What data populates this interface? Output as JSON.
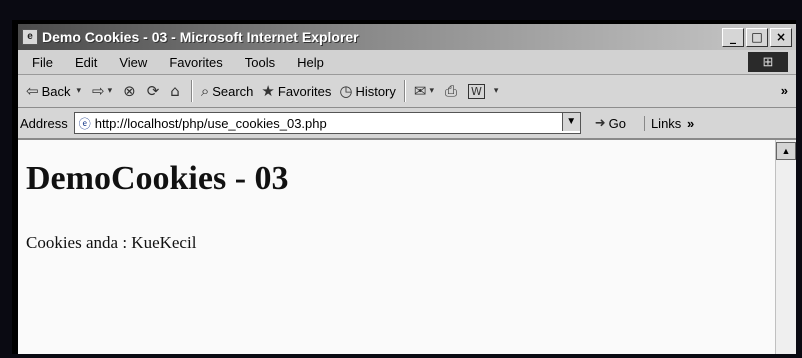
{
  "window": {
    "title": "Demo Cookies - 03 - Microsoft Internet Explorer",
    "controls": [
      "_",
      "□",
      "×"
    ]
  },
  "menubar": {
    "items": [
      "File",
      "Edit",
      "View",
      "Favorites",
      "Tools",
      "Help"
    ]
  },
  "toolbar": {
    "back_label": "Back",
    "search_label": "Search",
    "favorites_label": "Favorites",
    "history_label": "History"
  },
  "addressbar": {
    "label": "Address",
    "url": "http://localhost/php/use_cookies_03.php",
    "go_label": "Go",
    "links_label": "Links"
  },
  "page": {
    "heading": "DemoCookies - 03",
    "cookie_line": "Cookies anda : KueKecil"
  }
}
